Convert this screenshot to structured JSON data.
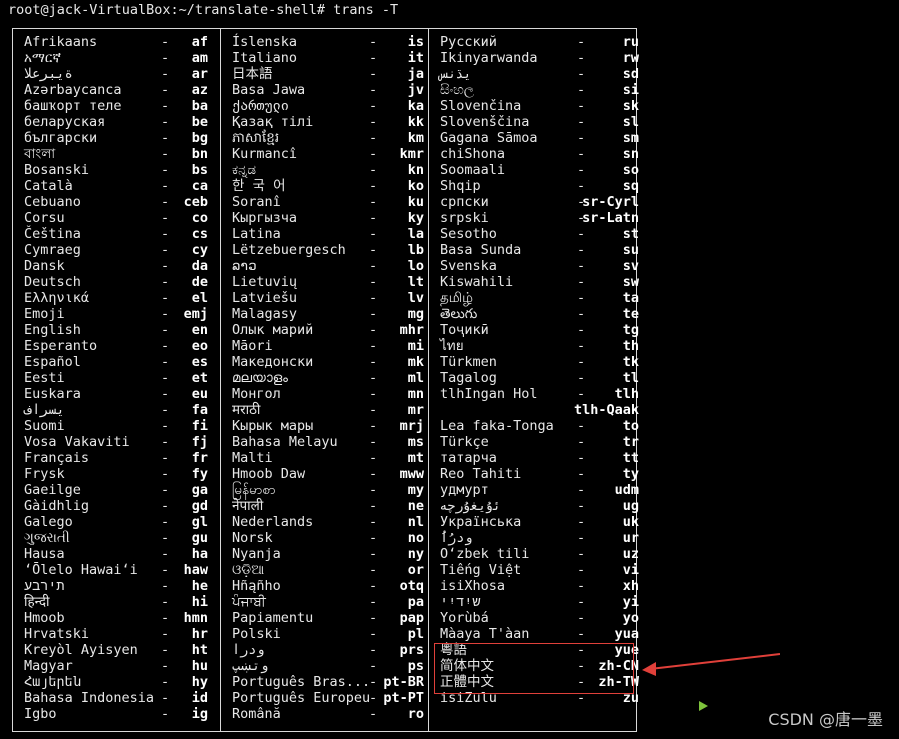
{
  "terminal": {
    "prompt": "root@jack-VirtualBox:~/translate-shell# trans -T",
    "watermark": "CSDN @唐一墨",
    "highlight_color": "#e0403a",
    "cursor_color": "#7ec33c"
  },
  "languages": {
    "col1": [
      {
        "name": "Afrikaans",
        "dash": "-",
        "code": "af"
      },
      {
        "name": "አማርኛ",
        "dash": "-",
        "code": "am"
      },
      {
        "name": "ةيبرعلا",
        "dash": "-",
        "code": "ar"
      },
      {
        "name": "Azərbaycanca",
        "dash": "-",
        "code": "az"
      },
      {
        "name": "башҡорт теле",
        "dash": "-",
        "code": "ba"
      },
      {
        "name": "беларуская",
        "dash": "-",
        "code": "be"
      },
      {
        "name": "български",
        "dash": "-",
        "code": "bg"
      },
      {
        "name": "বাংলা",
        "dash": "-",
        "code": "bn"
      },
      {
        "name": "Bosanski",
        "dash": "-",
        "code": "bs"
      },
      {
        "name": "Català",
        "dash": "-",
        "code": "ca"
      },
      {
        "name": "Cebuano",
        "dash": "-",
        "code": "ceb"
      },
      {
        "name": "Corsu",
        "dash": "-",
        "code": "co"
      },
      {
        "name": "Čeština",
        "dash": "-",
        "code": "cs"
      },
      {
        "name": "Cymraeg",
        "dash": "-",
        "code": "cy"
      },
      {
        "name": "Dansk",
        "dash": "-",
        "code": "da"
      },
      {
        "name": "Deutsch",
        "dash": "-",
        "code": "de"
      },
      {
        "name": "Ελληνικά",
        "dash": "-",
        "code": "el"
      },
      {
        "name": "Emoji",
        "dash": "-",
        "code": "emj"
      },
      {
        "name": "English",
        "dash": "-",
        "code": "en"
      },
      {
        "name": "Esperanto",
        "dash": "-",
        "code": "eo"
      },
      {
        "name": "Español",
        "dash": "-",
        "code": "es"
      },
      {
        "name": "Eesti",
        "dash": "-",
        "code": "et"
      },
      {
        "name": "Euskara",
        "dash": "-",
        "code": "eu"
      },
      {
        "name": "یسراف",
        "dash": "-",
        "code": "fa"
      },
      {
        "name": "Suomi",
        "dash": "-",
        "code": "fi"
      },
      {
        "name": "Vosa Vakaviti",
        "dash": "-",
        "code": "fj"
      },
      {
        "name": "Français",
        "dash": "-",
        "code": "fr"
      },
      {
        "name": "Frysk",
        "dash": "-",
        "code": "fy"
      },
      {
        "name": "Gaeilge",
        "dash": "-",
        "code": "ga"
      },
      {
        "name": "Gàidhlig",
        "dash": "-",
        "code": "gd"
      },
      {
        "name": "Galego",
        "dash": "-",
        "code": "gl"
      },
      {
        "name": "ગુજરાતી",
        "dash": "-",
        "code": "gu"
      },
      {
        "name": "Hausa",
        "dash": "-",
        "code": "ha"
      },
      {
        "name": "ʻŌlelo Hawaiʻi",
        "dash": "-",
        "code": "haw"
      },
      {
        "name": "תירבע",
        "dash": "-",
        "code": "he"
      },
      {
        "name": "हिन्दी",
        "dash": "-",
        "code": "hi"
      },
      {
        "name": "Hmoob",
        "dash": "-",
        "code": "hmn"
      },
      {
        "name": "Hrvatski",
        "dash": "-",
        "code": "hr"
      },
      {
        "name": "Kreyòl Ayisyen",
        "dash": "-",
        "code": "ht"
      },
      {
        "name": "Magyar",
        "dash": "-",
        "code": "hu"
      },
      {
        "name": "Հայերեն",
        "dash": "-",
        "code": "hy"
      },
      {
        "name": "Bahasa Indonesia",
        "dash": "-",
        "code": "id"
      },
      {
        "name": "Igbo",
        "dash": "-",
        "code": "ig"
      }
    ],
    "col2": [
      {
        "name": "Íslenska",
        "dash": "-",
        "code": "is"
      },
      {
        "name": "Italiano",
        "dash": "-",
        "code": "it"
      },
      {
        "name": "日本語",
        "dash": "-",
        "code": "ja"
      },
      {
        "name": "Basa Jawa",
        "dash": "-",
        "code": "jv"
      },
      {
        "name": "ქართული",
        "dash": "-",
        "code": "ka"
      },
      {
        "name": "Қазақ тілі",
        "dash": "-",
        "code": "kk"
      },
      {
        "name": "ភាសាខ្មែរ",
        "dash": "-",
        "code": "km"
      },
      {
        "name": "Kurmancî",
        "dash": "-",
        "code": "kmr"
      },
      {
        "name": "ಕನ್ನಡ",
        "dash": "-",
        "code": "kn"
      },
      {
        "name": "한 국 어",
        "dash": "-",
        "code": "ko"
      },
      {
        "name": "Soranî",
        "dash": "-",
        "code": "ku"
      },
      {
        "name": "Кыргызча",
        "dash": "-",
        "code": "ky"
      },
      {
        "name": "Latina",
        "dash": "-",
        "code": "la"
      },
      {
        "name": "Lëtzebuergesch",
        "dash": "-",
        "code": "lb"
      },
      {
        "name": "ລາວ",
        "dash": "-",
        "code": "lo"
      },
      {
        "name": "Lietuvių",
        "dash": "-",
        "code": "lt"
      },
      {
        "name": "Latviešu",
        "dash": "-",
        "code": "lv"
      },
      {
        "name": "Malagasy",
        "dash": "-",
        "code": "mg"
      },
      {
        "name": "Олык марий",
        "dash": "-",
        "code": "mhr"
      },
      {
        "name": "Māori",
        "dash": "-",
        "code": "mi"
      },
      {
        "name": "Македонски",
        "dash": "-",
        "code": "mk"
      },
      {
        "name": "മലയാളം",
        "dash": "-",
        "code": "ml"
      },
      {
        "name": "Монгол",
        "dash": "-",
        "code": "mn"
      },
      {
        "name": "मराठी",
        "dash": "-",
        "code": "mr"
      },
      {
        "name": "Кырык мары",
        "dash": "-",
        "code": "mrj"
      },
      {
        "name": "Bahasa Melayu",
        "dash": "-",
        "code": "ms"
      },
      {
        "name": "Malti",
        "dash": "-",
        "code": "mt"
      },
      {
        "name": "Hmoob Daw",
        "dash": "-",
        "code": "mww"
      },
      {
        "name": "မြန်မာစာ",
        "dash": "-",
        "code": "my"
      },
      {
        "name": "नेपाली",
        "dash": "-",
        "code": "ne"
      },
      {
        "name": "Nederlands",
        "dash": "-",
        "code": "nl"
      },
      {
        "name": "Norsk",
        "dash": "-",
        "code": "no"
      },
      {
        "name": "Nyanja",
        "dash": "-",
        "code": "ny"
      },
      {
        "name": "ଓଡ଼ିଆ",
        "dash": "-",
        "code": "or"
      },
      {
        "name": "Hñąñho",
        "dash": "-",
        "code": "otq"
      },
      {
        "name": "ਪੰਜਾਬੀ",
        "dash": "-",
        "code": "pa"
      },
      {
        "name": "Papiamentu",
        "dash": "-",
        "code": "pap"
      },
      {
        "name": "Polski",
        "dash": "-",
        "code": "pl"
      },
      {
        "name": "ودرا",
        "dash": "-",
        "code": "prs"
      },
      {
        "name": "وتښپ",
        "dash": "-",
        "code": "ps"
      },
      {
        "name": "Português Bras...",
        "dash": "-",
        "code": "pt-BR"
      },
      {
        "name": "Português Europeu",
        "dash": "-",
        "code": "pt-PT"
      },
      {
        "name": "Română",
        "dash": "-",
        "code": "ro"
      }
    ],
    "col3": [
      {
        "name": "Русский",
        "dash": "-",
        "code": "ru"
      },
      {
        "name": "Ikinyarwanda",
        "dash": "-",
        "code": "rw"
      },
      {
        "name": "يڌنس",
        "dash": "-",
        "code": "sd"
      },
      {
        "name": "සිංහල",
        "dash": "-",
        "code": "si"
      },
      {
        "name": "Slovenčina",
        "dash": "-",
        "code": "sk"
      },
      {
        "name": "Slovenščina",
        "dash": "-",
        "code": "sl"
      },
      {
        "name": "Gagana Sāmoa",
        "dash": "-",
        "code": "sm"
      },
      {
        "name": "chiShona",
        "dash": "-",
        "code": "sn"
      },
      {
        "name": "Soomaali",
        "dash": "-",
        "code": "so"
      },
      {
        "name": "Shqip",
        "dash": "-",
        "code": "sq"
      },
      {
        "name": "српски",
        "dash": "-",
        "code": "sr-Cyrl"
      },
      {
        "name": "srpski",
        "dash": "-",
        "code": "sr-Latn"
      },
      {
        "name": "Sesotho",
        "dash": "-",
        "code": "st"
      },
      {
        "name": "Basa Sunda",
        "dash": "-",
        "code": "su"
      },
      {
        "name": "Svenska",
        "dash": "-",
        "code": "sv"
      },
      {
        "name": "Kiswahili",
        "dash": "-",
        "code": "sw"
      },
      {
        "name": "தமிழ்",
        "dash": "-",
        "code": "ta"
      },
      {
        "name": "తెలుగు",
        "dash": "-",
        "code": "te"
      },
      {
        "name": "Тоҷикӣ",
        "dash": "-",
        "code": "tg"
      },
      {
        "name": "ไทย",
        "dash": "-",
        "code": "th"
      },
      {
        "name": "Türkmen",
        "dash": "-",
        "code": "tk"
      },
      {
        "name": "Tagalog",
        "dash": "-",
        "code": "tl"
      },
      {
        "name": "tlhIngan Hol",
        "dash": "-",
        "code": "tlh"
      },
      {
        "name": "",
        "dash": "",
        "code": "tlh-Qaak"
      },
      {
        "name": "Lea faka-Tonga",
        "dash": "-",
        "code": "to"
      },
      {
        "name": "Türkçe",
        "dash": "-",
        "code": "tr"
      },
      {
        "name": "татарча",
        "dash": "-",
        "code": "tt"
      },
      {
        "name": "Reo Tahiti",
        "dash": "-",
        "code": "ty"
      },
      {
        "name": "удмурт",
        "dash": "-",
        "code": "udm"
      },
      {
        "name": "ﺋۇﻳﻐۇﺭچە",
        "dash": "-",
        "code": "ug"
      },
      {
        "name": "Українська",
        "dash": "-",
        "code": "uk"
      },
      {
        "name": "ُودرُا",
        "dash": "-",
        "code": "ur"
      },
      {
        "name": "Oʻzbek tili",
        "dash": "-",
        "code": "uz"
      },
      {
        "name": "Tiếng Việt",
        "dash": "-",
        "code": "vi"
      },
      {
        "name": "isiXhosa",
        "dash": "-",
        "code": "xh"
      },
      {
        "name": "שיִדיִי",
        "dash": "-",
        "code": "yi"
      },
      {
        "name": "Yorùbá",
        "dash": "-",
        "code": "yo"
      },
      {
        "name": "Màaya T'àan",
        "dash": "-",
        "code": "yua"
      },
      {
        "name": "粵語",
        "dash": "-",
        "code": "yue"
      },
      {
        "name": "简体中文",
        "dash": "-",
        "code": "zh-CN"
      },
      {
        "name": "正體中文",
        "dash": "-",
        "code": "zh-TW"
      },
      {
        "name": "isiZulu",
        "dash": "-",
        "code": "zu"
      }
    ]
  }
}
